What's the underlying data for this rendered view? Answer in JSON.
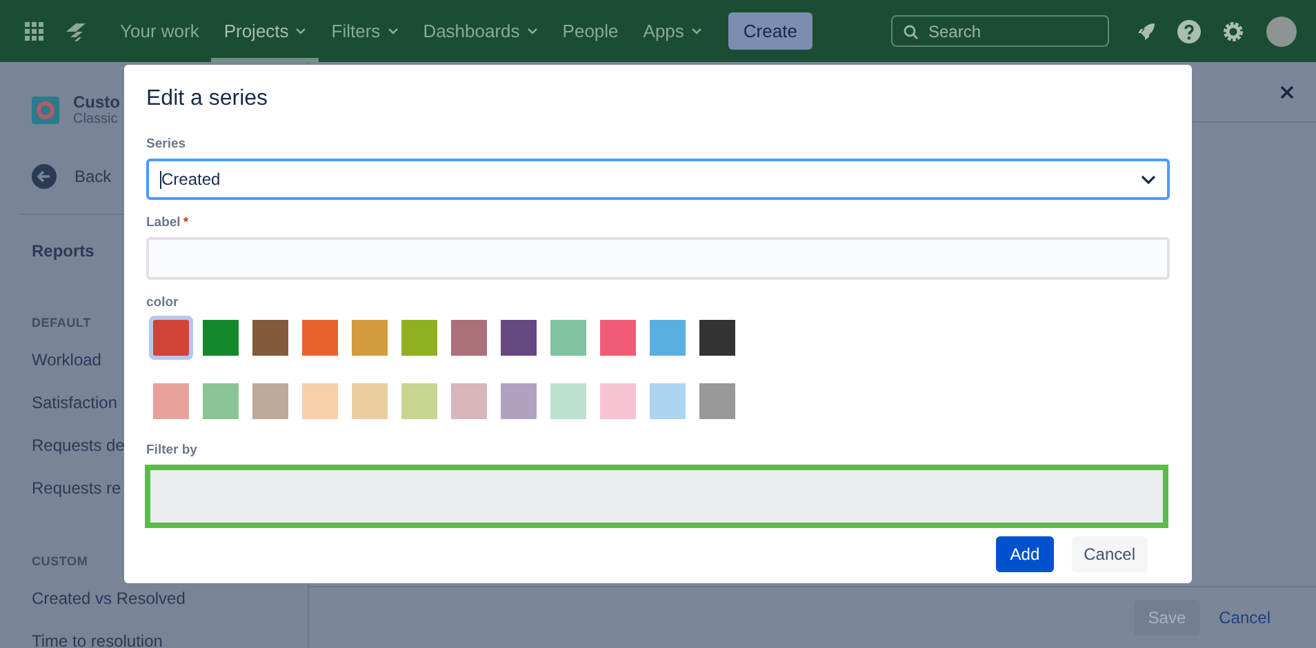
{
  "nav": {
    "items": [
      {
        "label": "Your work",
        "dropdown": false,
        "selected": false
      },
      {
        "label": "Projects",
        "dropdown": true,
        "selected": true
      },
      {
        "label": "Filters",
        "dropdown": true,
        "selected": false
      },
      {
        "label": "Dashboards",
        "dropdown": true,
        "selected": false
      },
      {
        "label": "People",
        "dropdown": false,
        "selected": false
      },
      {
        "label": "Apps",
        "dropdown": true,
        "selected": false
      }
    ],
    "create": "Create",
    "search_placeholder": "Search"
  },
  "sidebar": {
    "project_name": "Custo",
    "project_type": "Classic",
    "back": "Back",
    "reports_heading": "Reports",
    "sections": [
      {
        "heading": "DEFAULT",
        "items": [
          "Workload",
          "Satisfaction",
          "Requests de",
          "Requests re"
        ]
      },
      {
        "heading": "CUSTOM",
        "items": [
          "Created vs Resolved",
          "Time to resolution"
        ]
      }
    ]
  },
  "modal": {
    "title": "Edit a series",
    "series": {
      "label": "Series",
      "value": "Created"
    },
    "label_field": {
      "label": "Label",
      "required_mark": "*"
    },
    "color": {
      "label": "color",
      "swatches": [
        {
          "color": "#d04437",
          "selected": true
        },
        {
          "color": "#14892c",
          "selected": false
        },
        {
          "color": "#815b3a",
          "selected": false
        },
        {
          "color": "#e8632b",
          "selected": false
        },
        {
          "color": "#d39c3f",
          "selected": false
        },
        {
          "color": "#8eb021",
          "selected": false
        },
        {
          "color": "#ac707a",
          "selected": false
        },
        {
          "color": "#654982",
          "selected": false
        },
        {
          "color": "#80c2a1",
          "selected": false
        },
        {
          "color": "#f15c75",
          "selected": false
        },
        {
          "color": "#59afe1",
          "selected": false
        },
        {
          "color": "#333333",
          "selected": false
        },
        {
          "color": "#e9a29b",
          "selected": false
        },
        {
          "color": "#8ac394",
          "selected": false
        },
        {
          "color": "#c0a998",
          "selected": false
        },
        {
          "color": "#f7cfa8",
          "selected": false
        },
        {
          "color": "#ebcc9d",
          "selected": false
        },
        {
          "color": "#c7d690",
          "selected": false
        },
        {
          "color": "#d7b6bc",
          "selected": false
        },
        {
          "color": "#b1a1c1",
          "selected": false
        },
        {
          "color": "#bee0cf",
          "selected": false
        },
        {
          "color": "#f7c3d3",
          "selected": false
        },
        {
          "color": "#acd6ef",
          "selected": false
        },
        {
          "color": "#999999",
          "selected": false
        }
      ]
    },
    "filter": {
      "label": "Filter by",
      "highlighted": true
    },
    "add": "Add",
    "cancel": "Cancel"
  },
  "footer": {
    "save": "Save",
    "save_disabled": true,
    "cancel": "Cancel"
  }
}
